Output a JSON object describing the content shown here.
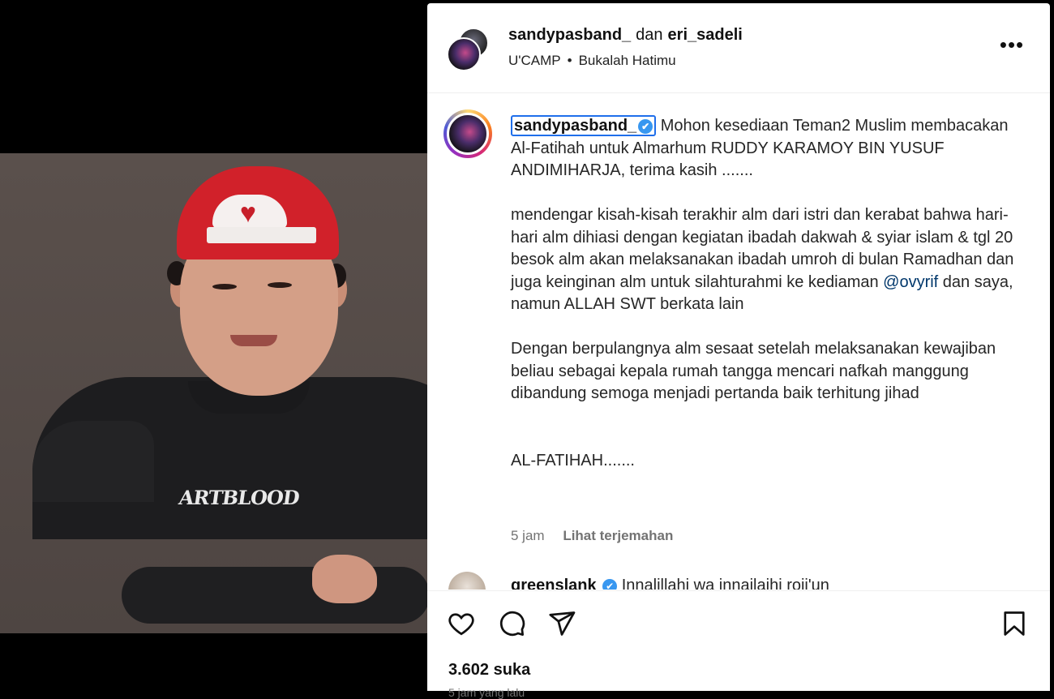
{
  "post": {
    "owner_primary": "sandypasband_",
    "owner_joiner": "dan",
    "owner_secondary": "eri_sadeli",
    "location": "U'CAMP",
    "audio": "Bukalah Hatimu",
    "more_label": "•••"
  },
  "caption": {
    "username": "sandypasband_",
    "verified_symbol": "✔",
    "para1": "Mohon kesediaan Teman2 Muslim membacakan Al-Fatihah untuk Almarhum RUDDY KARAMOY BIN YUSUF ANDIMIHARJA, terima kasih .......",
    "para2_before": "mendengar kisah-kisah terakhir alm dari istri dan kerabat bahwa hari-hari alm dihiasi dengan kegiatan ibadah dakwah & syiar islam & tgl 20 besok alm akan melaksanakan ibadah umroh di bulan Ramadhan dan juga keinginan alm untuk silahturahmi ke kediaman ",
    "para2_mention": "@ovyrif",
    "para2_after": " dan saya, namun ALLAH SWT berkata lain",
    "para3": "Dengan berpulangnya alm sesaat setelah melaksanakan kewajiban beliau sebagai kepala rumah tangga mencari nafkah manggung dibandung semoga menjadi pertanda baik terhitung jihad",
    "para4": "AL-FATIHAH.......",
    "time_ago": "5 jam",
    "translate_label": "Lihat terjemahan"
  },
  "comment": {
    "username": "greenslank",
    "text": "Innalillahi wa innailaihi roji'un"
  },
  "actions": {
    "likes": "3.602 suka",
    "posted": "5 jam yang lalu"
  },
  "media": {
    "shirt_print": "ARTBLOOD"
  },
  "colors": {
    "accent_blue": "#3897f0",
    "mention": "#00376b",
    "cap_red": "#d1212a"
  },
  "icons": [
    "heart-icon",
    "comment-icon",
    "share-icon",
    "bookmark-icon",
    "more-icon",
    "verified-icon"
  ]
}
